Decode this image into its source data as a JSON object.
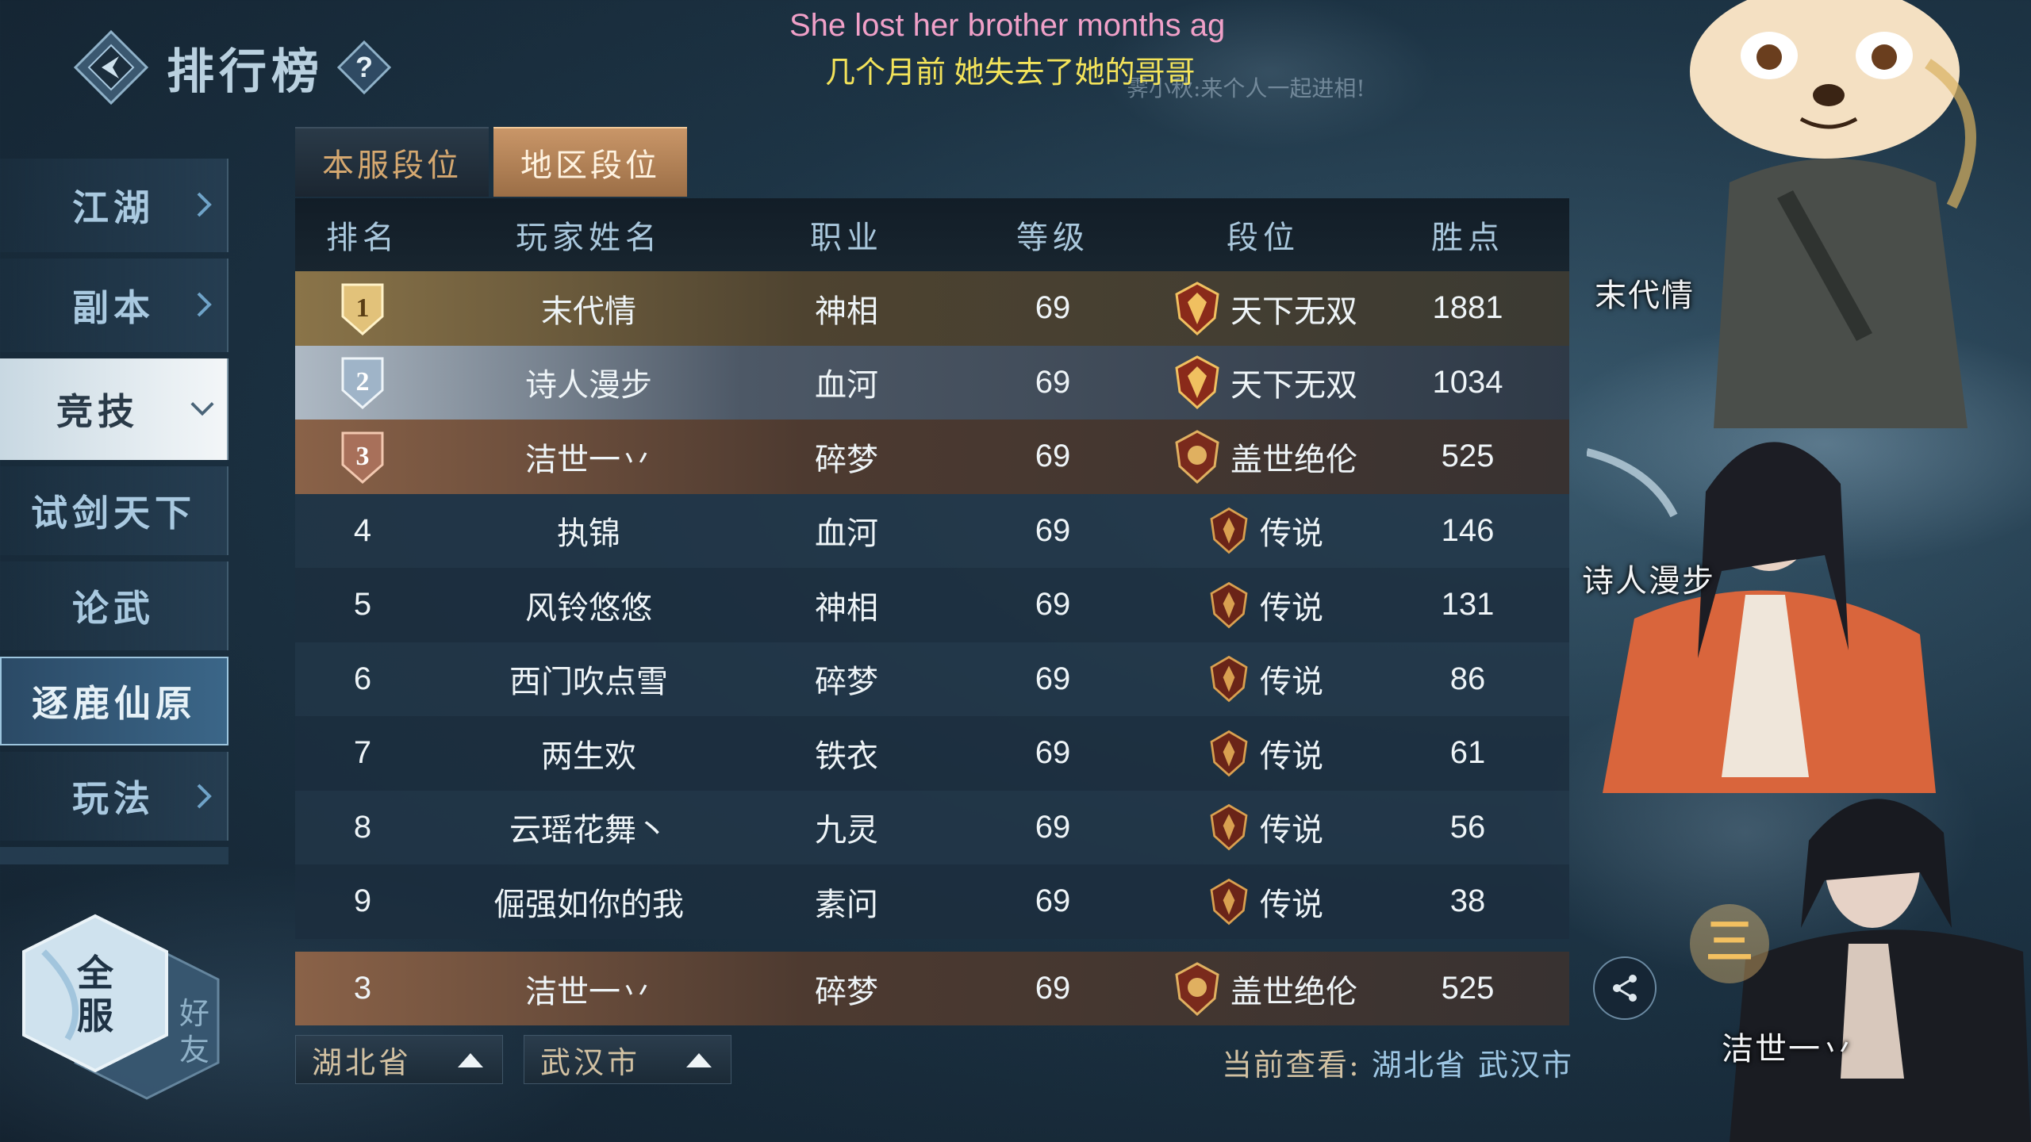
{
  "header": {
    "title": "排行榜"
  },
  "subtitles": {
    "english": "She lost her brother months ag",
    "chinese": "几个月前 她失去了她的哥哥",
    "chat": "霁小秋:来个人一起进相!"
  },
  "nav": {
    "items": [
      {
        "label": "江湖",
        "has_arrow": true
      },
      {
        "label": "副本",
        "has_arrow": true
      },
      {
        "label": "竞技",
        "expanded": true
      },
      {
        "label": "试剑天下"
      },
      {
        "label": "论武"
      },
      {
        "label": "逐鹿仙原",
        "selected": true
      },
      {
        "label": "玩法",
        "has_arrow": true
      }
    ]
  },
  "server_toggle": {
    "all": "全服",
    "friends": "好友"
  },
  "tabs": [
    {
      "label": "本服段位",
      "active": false
    },
    {
      "label": "地区段位",
      "active": true
    }
  ],
  "table": {
    "headers": {
      "rank": "排名",
      "name": "玩家姓名",
      "job": "职业",
      "level": "等级",
      "tier": "段位",
      "points": "胜点"
    },
    "rows": [
      {
        "rank": "1",
        "name": "末代情",
        "job": "神相",
        "level": "69",
        "tier": "天下无双",
        "points": "1881"
      },
      {
        "rank": "2",
        "name": "诗人漫步",
        "job": "血河",
        "level": "69",
        "tier": "天下无双",
        "points": "1034"
      },
      {
        "rank": "3",
        "name": "洁世一丷",
        "job": "碎梦",
        "level": "69",
        "tier": "盖世绝伦",
        "points": "525"
      },
      {
        "rank": "4",
        "name": "执锦",
        "job": "血河",
        "level": "69",
        "tier": "传说",
        "points": "146"
      },
      {
        "rank": "5",
        "name": "风铃悠悠",
        "job": "神相",
        "level": "69",
        "tier": "传说",
        "points": "131"
      },
      {
        "rank": "6",
        "name": "西门吹点雪",
        "job": "碎梦",
        "level": "69",
        "tier": "传说",
        "points": "86"
      },
      {
        "rank": "7",
        "name": "两生欢",
        "job": "铁衣",
        "level": "69",
        "tier": "传说",
        "points": "61"
      },
      {
        "rank": "8",
        "name": "云瑶花舞丶",
        "job": "九灵",
        "level": "69",
        "tier": "传说",
        "points": "56"
      },
      {
        "rank": "9",
        "name": "倔强如你的我",
        "job": "素问",
        "level": "69",
        "tier": "传说",
        "points": "38"
      }
    ]
  },
  "my_row": {
    "rank": "3",
    "name": "洁世一丷",
    "job": "碎梦",
    "level": "69",
    "tier": "盖世绝伦",
    "points": "525"
  },
  "filters": {
    "province": "湖北省",
    "city": "武汉市"
  },
  "viewing": {
    "label": "当前查看:",
    "value": "湖北省 武汉市"
  },
  "portraits": [
    {
      "name": "末代情"
    },
    {
      "name": "诗人漫步"
    },
    {
      "name": "洁世一丷"
    }
  ],
  "colors": {
    "gold_row": "#8a7449",
    "silver_row": "#aeb9c4",
    "bronze_row": "#8a6248",
    "active_tab": "#c99668"
  }
}
